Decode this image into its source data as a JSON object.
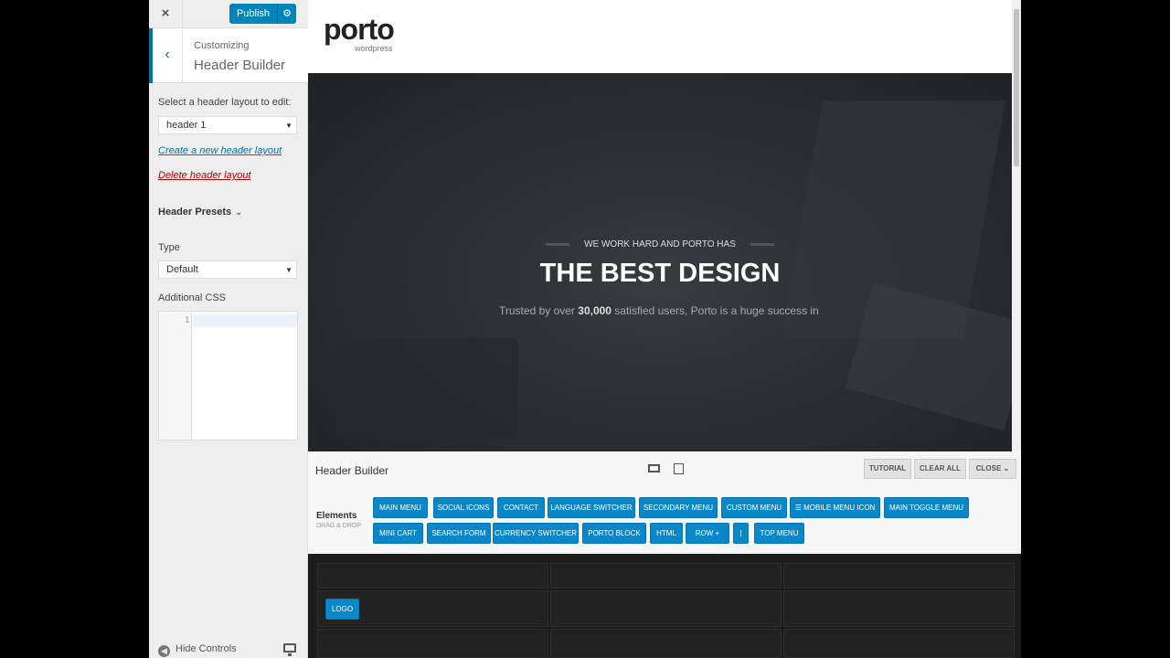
{
  "sidebar": {
    "close_icon": "×",
    "publish_label": "Publish",
    "publish_gear_icon": "gear-icon",
    "back_icon": "‹",
    "customizing_label": "Customizing",
    "section_title": "Header Builder",
    "select_layout_label": "Select a header layout to edit:",
    "layout_value": "header 1",
    "create_link": "Create a new header layout",
    "delete_link": "Delete header layout",
    "presets_label": "Header Presets",
    "type_label": "Type",
    "type_value": "Default",
    "additional_css_label": "Additional CSS",
    "css_line_number": "1",
    "hide_controls_label": "Hide Controls"
  },
  "preview": {
    "logo_text": "porto",
    "logo_sub": "wordpress",
    "kicker": "WE WORK HARD AND PORTO HAS",
    "title": "THE BEST DESIGN",
    "subtitle_pre": "Trusted by over ",
    "subtitle_bold": "30,000",
    "subtitle_post": " satisfied users, Porto is a huge success in t"
  },
  "header_builder": {
    "title": "Header Builder",
    "tutorial_label": "TUTORIAL",
    "clear_all_label": "CLEAR ALL",
    "close_label": "CLOSE",
    "elements_label": "Elements",
    "elements_sub": "DRAG & DROP",
    "elements_row1": [
      "MAIN MENU",
      "SOCIAL ICONS",
      "CONTACT",
      "LANGUAGE SWITCHER",
      "SECONDARY MENU",
      "CUSTOM MENU",
      "☰ MOBILE MENU ICON",
      "MAIN TOGGLE MENU"
    ],
    "elements_row2": [
      "MINI CART",
      "SEARCH FORM",
      "CURRENCY SWITCHER",
      "PORTO BLOCK",
      "HTML",
      "ROW +",
      "|",
      "TOP MENU"
    ],
    "logo_chip": "LOGO"
  },
  "colors": {
    "accent": "#0085ba",
    "chip": "#0a87c9",
    "link": "#0073aa",
    "danger": "#aa0000"
  }
}
